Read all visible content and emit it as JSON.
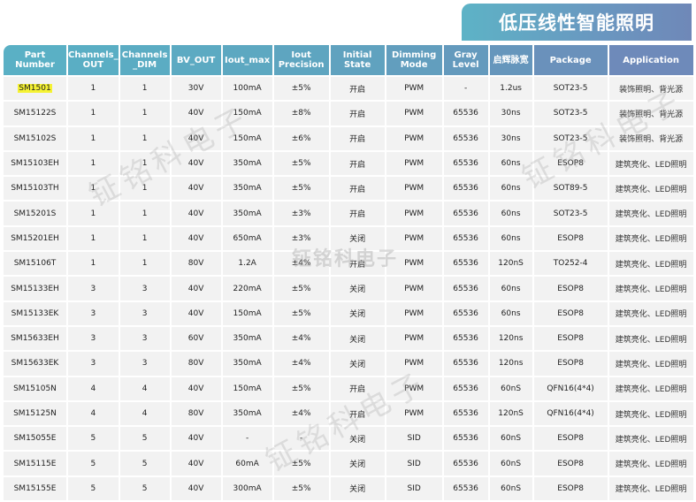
{
  "banner": {
    "title": "低压线性智能照明"
  },
  "watermark": "钲铭科电子",
  "table": {
    "headers": [
      {
        "label": "Part Number",
        "color": "#5ab0c5"
      },
      {
        "label": "Channels_ OUT",
        "color": "#5aaec4"
      },
      {
        "label": "Channels _DIM",
        "color": "#5bacc3"
      },
      {
        "label": "BV_OUT",
        "color": "#5caac2"
      },
      {
        "label": "Iout_max",
        "color": "#5da8c1"
      },
      {
        "label": "Iout Precision",
        "color": "#5ea5c0"
      },
      {
        "label": "Initial State",
        "color": "#60a2bf"
      },
      {
        "label": "Dimming Mode",
        "color": "#629ebe"
      },
      {
        "label": "Gray Level",
        "color": "#649abd"
      },
      {
        "label": "启辉脉宽",
        "color": "#6696bc"
      },
      {
        "label": "Package",
        "color": "#6a91bb"
      },
      {
        "label": "Application",
        "color": "#6e8aba"
      }
    ],
    "rows": [
      {
        "part": "SM1501",
        "ch_out": "1",
        "ch_dim": "1",
        "bv": "30V",
        "iout": "100mA",
        "prec": "±5%",
        "state": "开启",
        "mode": "PWM",
        "gray": "-",
        "pulse": "1.2us",
        "pkg": "SOT23-5",
        "app": "装饰照明、背光源",
        "highlight": true
      },
      {
        "part": "SM15122S",
        "ch_out": "1",
        "ch_dim": "1",
        "bv": "40V",
        "iout": "150mA",
        "prec": "±8%",
        "state": "开启",
        "mode": "PWM",
        "gray": "65536",
        "pulse": "30ns",
        "pkg": "SOT23-5",
        "app": "装饰照明、背光源"
      },
      {
        "part": "SM15102S",
        "ch_out": "1",
        "ch_dim": "1",
        "bv": "40V",
        "iout": "150mA",
        "prec": "±6%",
        "state": "开启",
        "mode": "PWM",
        "gray": "65536",
        "pulse": "30ns",
        "pkg": "SOT23-5",
        "app": "装饰照明、背光源"
      },
      {
        "part": "SM15103EH",
        "ch_out": "1",
        "ch_dim": "1",
        "bv": "40V",
        "iout": "350mA",
        "prec": "±5%",
        "state": "开启",
        "mode": "PWM",
        "gray": "65536",
        "pulse": "60ns",
        "pkg": "ESOP8",
        "app": "建筑亮化、LED照明"
      },
      {
        "part": "SM15103TH",
        "ch_out": "1",
        "ch_dim": "1",
        "bv": "40V",
        "iout": "350mA",
        "prec": "±5%",
        "state": "开启",
        "mode": "PWM",
        "gray": "65536",
        "pulse": "60ns",
        "pkg": "SOT89-5",
        "app": "建筑亮化、LED照明"
      },
      {
        "part": "SM15201S",
        "ch_out": "1",
        "ch_dim": "1",
        "bv": "40V",
        "iout": "350mA",
        "prec": "±3%",
        "state": "开启",
        "mode": "PWM",
        "gray": "65536",
        "pulse": "60ns",
        "pkg": "SOT23-5",
        "app": "建筑亮化、LED照明"
      },
      {
        "part": "SM15201EH",
        "ch_out": "1",
        "ch_dim": "1",
        "bv": "40V",
        "iout": "650mA",
        "prec": "±3%",
        "state": "关闭",
        "mode": "PWM",
        "gray": "65536",
        "pulse": "60ns",
        "pkg": "ESOP8",
        "app": "建筑亮化、LED照明"
      },
      {
        "part": "SM15106T",
        "ch_out": "1",
        "ch_dim": "1",
        "bv": "80V",
        "iout": "1.2A",
        "prec": "±4%",
        "state": "开启",
        "mode": "PWM",
        "gray": "65536",
        "pulse": "120nS",
        "pkg": "TO252-4",
        "app": "建筑亮化、LED照明"
      },
      {
        "part": "SM15133EH",
        "ch_out": "3",
        "ch_dim": "3",
        "bv": "40V",
        "iout": "220mA",
        "prec": "±5%",
        "state": "关闭",
        "mode": "PWM",
        "gray": "65536",
        "pulse": "60ns",
        "pkg": "ESOP8",
        "app": "建筑亮化、LED照明"
      },
      {
        "part": "SM15133EK",
        "ch_out": "3",
        "ch_dim": "3",
        "bv": "40V",
        "iout": "150mA",
        "prec": "±5%",
        "state": "关闭",
        "mode": "PWM",
        "gray": "65536",
        "pulse": "60ns",
        "pkg": "ESOP8",
        "app": "建筑亮化、LED照明"
      },
      {
        "part": "SM15633EH",
        "ch_out": "3",
        "ch_dim": "3",
        "bv": "60V",
        "iout": "350mA",
        "prec": "±4%",
        "state": "关闭",
        "mode": "PWM",
        "gray": "65536",
        "pulse": "120ns",
        "pkg": "ESOP8",
        "app": "建筑亮化、LED照明"
      },
      {
        "part": "SM15633EK",
        "ch_out": "3",
        "ch_dim": "3",
        "bv": "80V",
        "iout": "350mA",
        "prec": "±4%",
        "state": "关闭",
        "mode": "PWM",
        "gray": "65536",
        "pulse": "120ns",
        "pkg": "ESOP8",
        "app": "建筑亮化、LED照明"
      },
      {
        "part": "SM15105N",
        "ch_out": "4",
        "ch_dim": "4",
        "bv": "40V",
        "iout": "150mA",
        "prec": "±5%",
        "state": "开启",
        "mode": "PWM",
        "gray": "65536",
        "pulse": "60nS",
        "pkg": "QFN16(4*4)",
        "app": "建筑亮化、LED照明"
      },
      {
        "part": "SM15125N",
        "ch_out": "4",
        "ch_dim": "4",
        "bv": "80V",
        "iout": "350mA",
        "prec": "±4%",
        "state": "开启",
        "mode": "PWM",
        "gray": "65536",
        "pulse": "120nS",
        "pkg": "QFN16(4*4)",
        "app": "建筑亮化、LED照明"
      },
      {
        "part": "SM15055E",
        "ch_out": "5",
        "ch_dim": "5",
        "bv": "40V",
        "iout": "-",
        "prec": "-",
        "state": "关闭",
        "mode": "SID",
        "gray": "65536",
        "pulse": "60nS",
        "pkg": "ESOP8",
        "app": "建筑亮化、LED照明"
      },
      {
        "part": "SM15115E",
        "ch_out": "5",
        "ch_dim": "5",
        "bv": "40V",
        "iout": "60mA",
        "prec": "±5%",
        "state": "关闭",
        "mode": "SID",
        "gray": "65536",
        "pulse": "60nS",
        "pkg": "ESOP8",
        "app": "建筑亮化、LED照明"
      },
      {
        "part": "SM15155E",
        "ch_out": "5",
        "ch_dim": "5",
        "bv": "40V",
        "iout": "300mA",
        "prec": "±5%",
        "state": "关闭",
        "mode": "SID",
        "gray": "65536",
        "pulse": "60nS",
        "pkg": "ESOP8",
        "app": "建筑亮化、LED照明"
      }
    ]
  },
  "colors": {
    "highlight": "#f5f233",
    "cell_bg": "#f2f2f2"
  }
}
